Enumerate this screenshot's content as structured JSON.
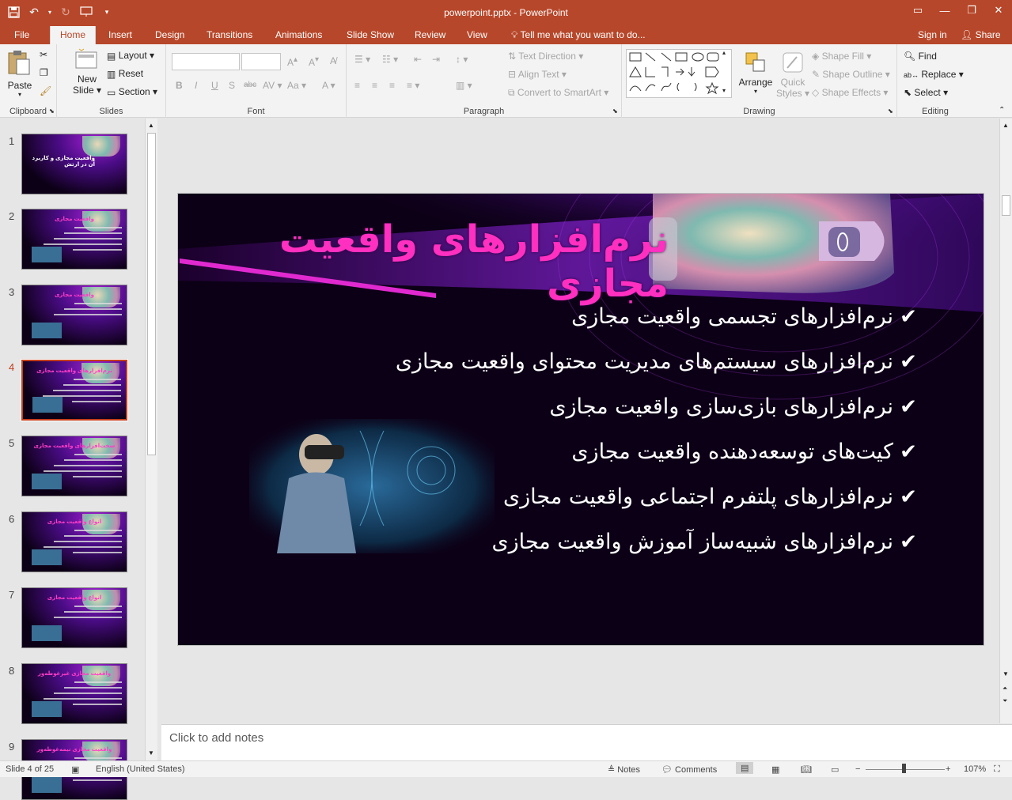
{
  "window": {
    "title": "powerpoint.pptx - PowerPoint",
    "sign_in": "Sign in",
    "share": "Share"
  },
  "tabs": [
    "File",
    "Home",
    "Insert",
    "Design",
    "Transitions",
    "Animations",
    "Slide Show",
    "Review",
    "View"
  ],
  "tell_me": "Tell me what you want to do...",
  "ribbon": {
    "clipboard": {
      "label": "Clipboard",
      "paste": "Paste"
    },
    "slides": {
      "label": "Slides",
      "new_slide": "New",
      "new_slide2": "Slide",
      "layout": "Layout",
      "reset": "Reset",
      "section": "Section"
    },
    "font": {
      "label": "Font"
    },
    "paragraph": {
      "label": "Paragraph",
      "text_direction": "Text Direction",
      "align_text": "Align Text",
      "convert_smartart": "Convert to SmartArt"
    },
    "drawing": {
      "label": "Drawing",
      "arrange": "Arrange",
      "quick_styles": "Quick",
      "quick_styles2": "Styles",
      "shape_fill": "Shape Fill",
      "shape_outline": "Shape Outline",
      "shape_effects": "Shape Effects"
    },
    "editing": {
      "label": "Editing",
      "find": "Find",
      "replace": "Replace",
      "select": "Select"
    }
  },
  "thumbnails": [
    {
      "num": "1",
      "title": "واقعیت مجازی و کاربرد آن در ارتش"
    },
    {
      "num": "2",
      "title": "واقعیت مجازی"
    },
    {
      "num": "3",
      "title": "واقعیت مجازی"
    },
    {
      "num": "4",
      "title": "نرم‌افزارهای واقعیت مجازی"
    },
    {
      "num": "5",
      "title": "سخت‌افزارهای واقعیت مجازی"
    },
    {
      "num": "6",
      "title": "انواع واقعیت مجازی"
    },
    {
      "num": "7",
      "title": "انواع واقعیت مجازی"
    },
    {
      "num": "8",
      "title": "واقعیت مجازی غیرغوطه‌ور"
    },
    {
      "num": "9",
      "title": "واقعیت مجازی نیمه‌غوطه‌ور"
    }
  ],
  "slide": {
    "title": "نرم‌افزارهای واقعیت مجازی",
    "bullets": [
      "نرم‌افزارهای تجسمی واقعیت مجازی",
      "نرم‌افزارهای سیستم‌های مدیریت محتوای واقعیت مجازی",
      "نرم‌افزارهای بازی‌سازی واقعیت مجازی",
      "کیت‌های توسعه‌دهنده واقعیت مجازی",
      "نرم‌افزارهای پلتفرم اجتماعی واقعیت مجازی",
      "نرم‌افزارهای شبیه‌ساز آموزش واقعیت مجازی"
    ]
  },
  "notes_placeholder": "Click to add notes",
  "status": {
    "slide_info": "Slide 4 of 25",
    "language": "English (United States)",
    "notes": "Notes",
    "comments": "Comments",
    "zoom": "107%"
  },
  "colors": {
    "accent": "#b7472a",
    "slide_title": "#ff2fc0",
    "slide_bg": "#0c0016"
  }
}
